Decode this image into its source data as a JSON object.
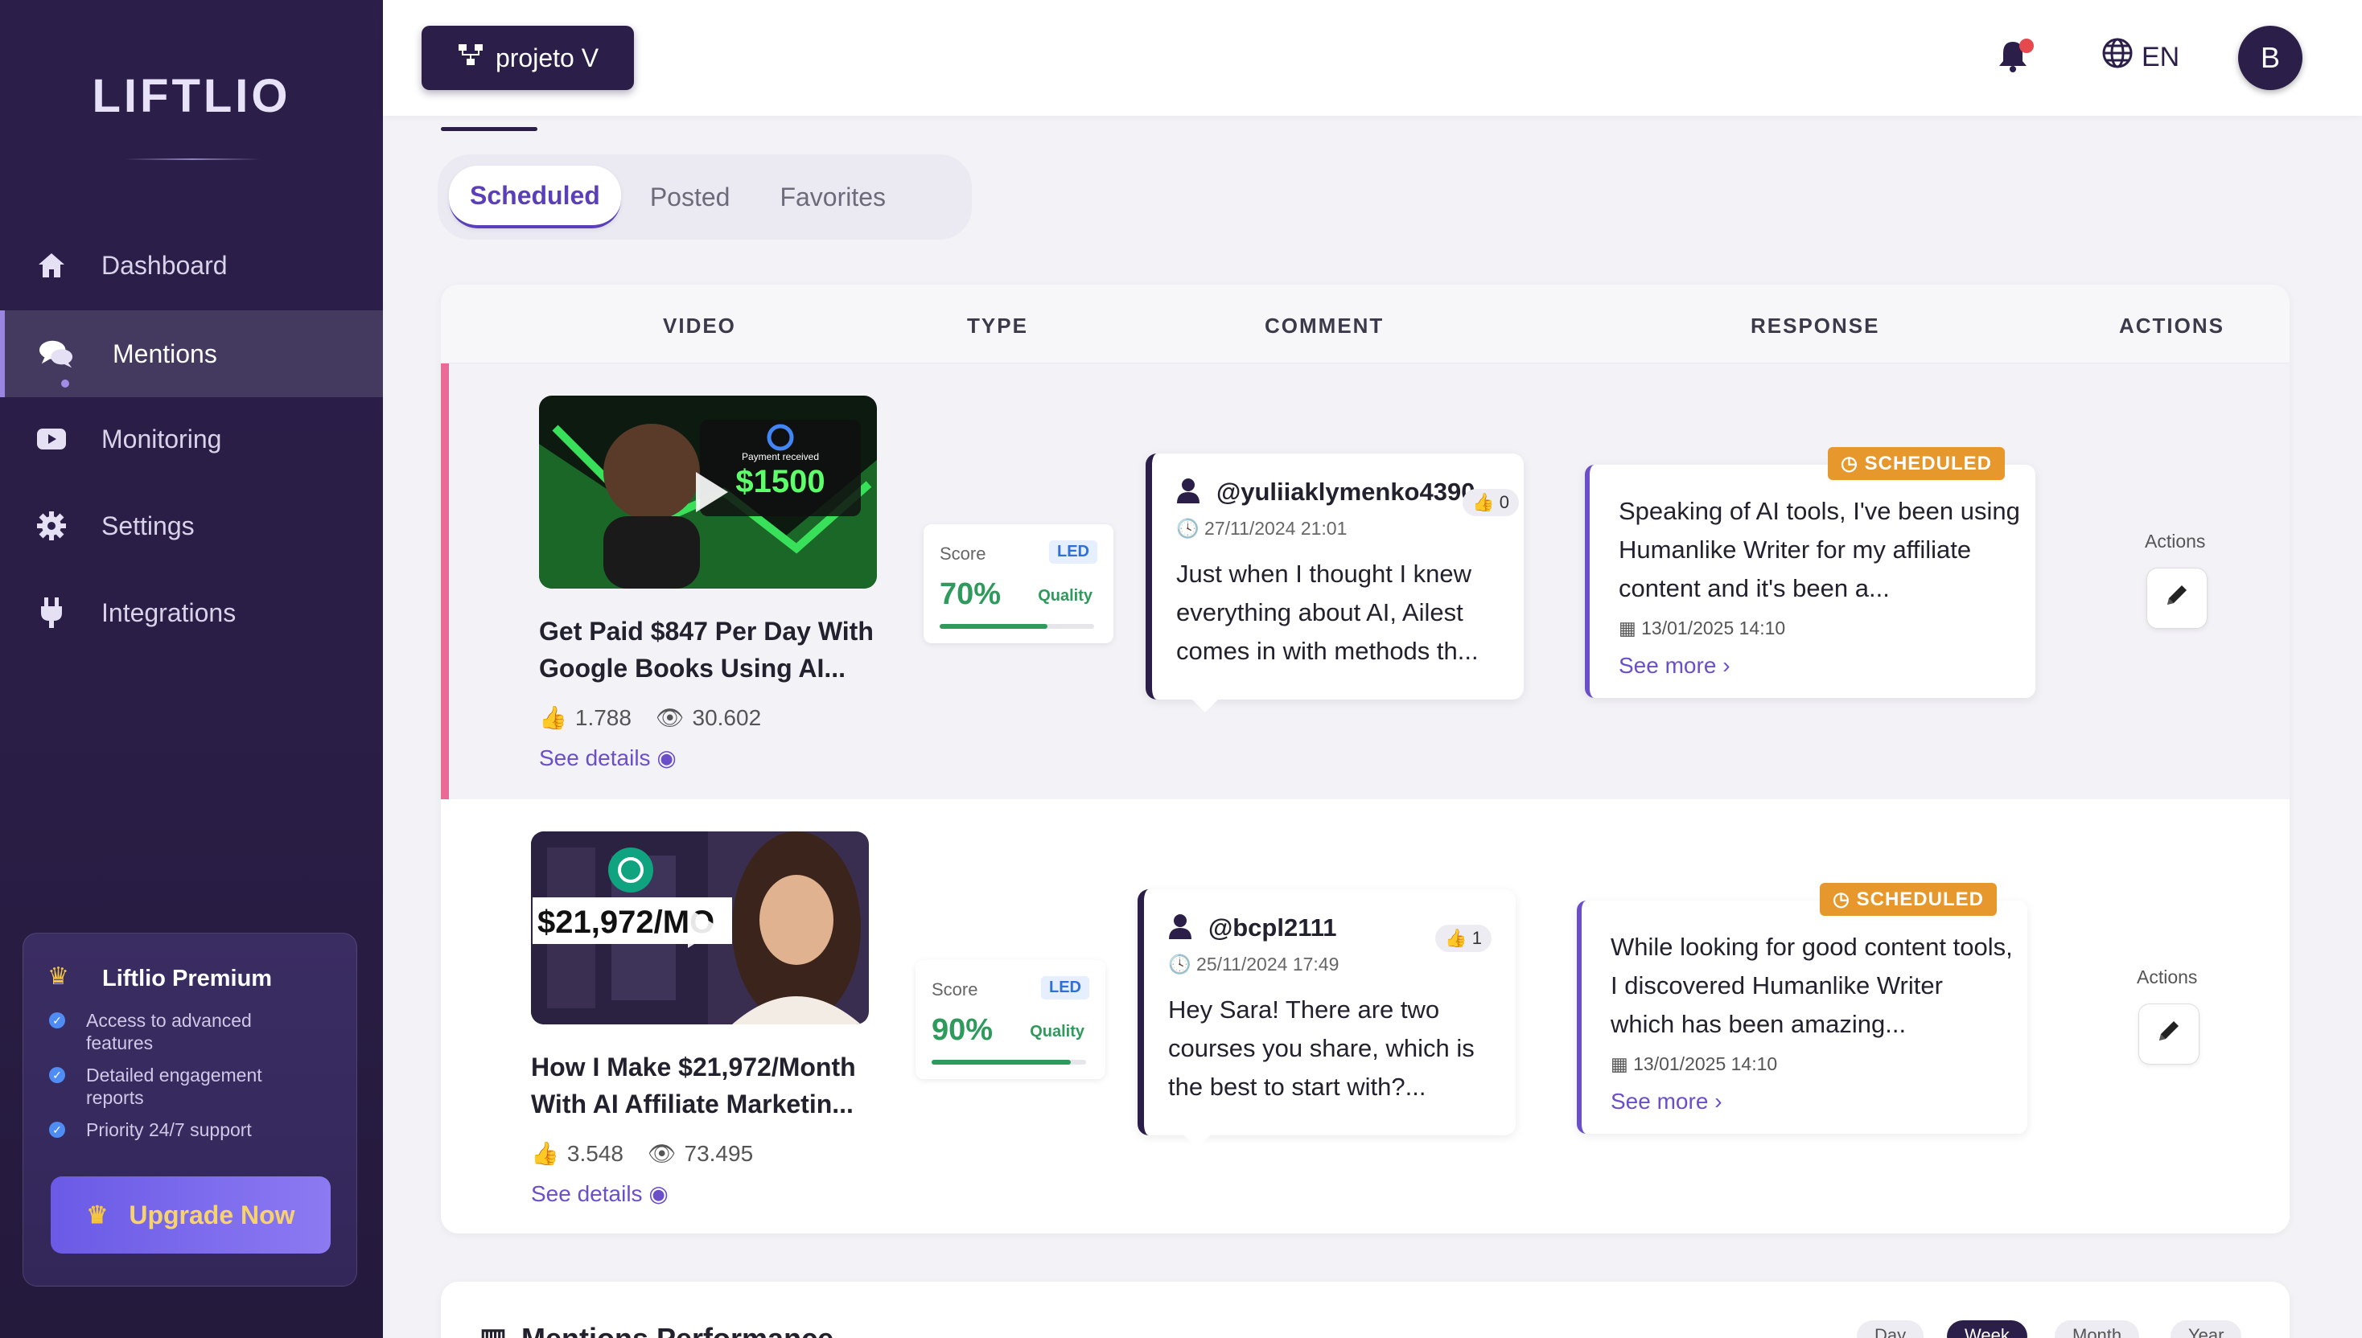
{
  "sidebar": {
    "logo": "LIFTLIO",
    "items": [
      {
        "label": "Dashboard",
        "icon": "home-icon"
      },
      {
        "label": "Mentions",
        "icon": "chat-icon"
      },
      {
        "label": "Monitoring",
        "icon": "youtube-icon"
      },
      {
        "label": "Settings",
        "icon": "gear-icon"
      },
      {
        "label": "Integrations",
        "icon": "plug-icon"
      }
    ],
    "premium": {
      "title": "Liftlio Premium",
      "features": [
        "Access to advanced features",
        "Detailed engagement reports",
        "Priority 24/7 support"
      ],
      "upgrade_label": "Upgrade Now"
    }
  },
  "topbar": {
    "project": "projeto V",
    "language": "EN",
    "avatar_initial": "B"
  },
  "tabs": [
    "Scheduled",
    "Posted",
    "Favorites"
  ],
  "table": {
    "headers": [
      "VIDEO",
      "TYPE",
      "COMMENT",
      "RESPONSE",
      "ACTIONS"
    ],
    "rows": [
      {
        "video_title": "Get Paid $847 Per Day With Google Books Using AI...",
        "thumb_text": "$1500",
        "thumb_sub": "Payment received",
        "likes": "1.788",
        "views": "30.602",
        "see_details": "See details",
        "score_label": "Score",
        "score_tag": "LED",
        "score_pct": "70%",
        "score_value": 0.7,
        "quality_label": "Quality",
        "comment_user": "@yuliiaklymenko4390",
        "comment_likes": "0",
        "comment_date": "27/11/2024 21:01",
        "comment_text": "Just when I thought I knew everything about AI, Ailest comes in with methods th...",
        "badge": "SCHEDULED",
        "response_text": "Speaking of AI tools, I've been using Humanlike Writer for my affiliate content and it's been a...",
        "response_date": "13/01/2025 14:10",
        "see_more": "See more",
        "actions_label": "Actions"
      },
      {
        "video_title": "How I Make $21,972/Month With AI Affiliate Marketin...",
        "thumb_text": "$21,972/MO",
        "thumb_sub": "",
        "likes": "3.548",
        "views": "73.495",
        "see_details": "See details",
        "score_label": "Score",
        "score_tag": "LED",
        "score_pct": "90%",
        "score_value": 0.9,
        "quality_label": "Quality",
        "comment_user": "@bcpl2111",
        "comment_likes": "1",
        "comment_date": "25/11/2024 17:49",
        "comment_text": "Hey Sara! There are two courses you share, which is the best to start with?...",
        "badge": "SCHEDULED",
        "response_text": "While looking for good content tools, I discovered Humanlike Writer which has been amazing...",
        "response_date": "13/01/2025 14:10",
        "see_more": "See more",
        "actions_label": "Actions"
      }
    ]
  },
  "performance": {
    "title": "Mentions Performance",
    "ranges": [
      "Day",
      "Week",
      "Month",
      "Year"
    ]
  },
  "colors": {
    "sidebar_bg": "#2b1f4a",
    "accent": "#6b4fc8",
    "scheduled_badge": "#e6982c",
    "score_green": "#2e9a5c",
    "row_highlight": "#e86a95"
  }
}
